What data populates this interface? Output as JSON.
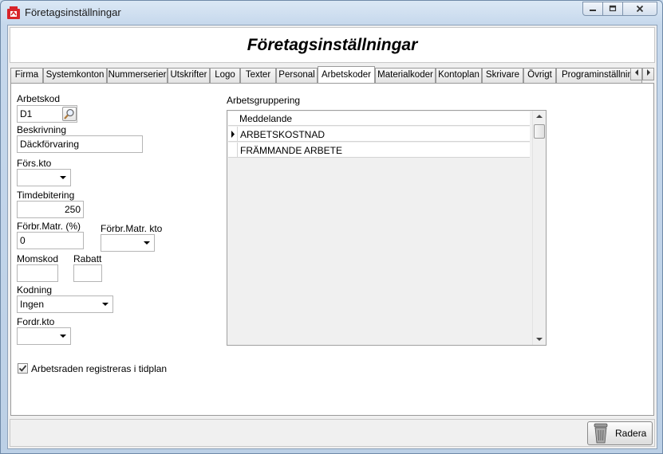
{
  "window": {
    "title": "Företagsinställningar"
  },
  "header": {
    "title": "Företagsinställningar"
  },
  "tabs": [
    "Firma",
    "Systemkonton",
    "Nummerserier",
    "Utskrifter",
    "Logo",
    "Texter",
    "Personal",
    "Arbetskoder",
    "Materialkoder",
    "Kontoplan",
    "Skrivare",
    "Övrigt",
    "Programinställningar"
  ],
  "active_tab": "Arbetskoder",
  "form": {
    "arbetskod": {
      "label": "Arbetskod",
      "value": "D1"
    },
    "beskrivning": {
      "label": "Beskrivning",
      "value": "Däckförvaring"
    },
    "fors_kto": {
      "label": "Förs.kto",
      "value": ""
    },
    "timdebitering": {
      "label": "Timdebitering",
      "value": "250"
    },
    "forbr_matr_pct": {
      "label": "Förbr.Matr. (%)",
      "value": "0"
    },
    "forbr_matr_kto": {
      "label": "Förbr.Matr. kto",
      "value": ""
    },
    "momskod": {
      "label": "Momskod",
      "value": ""
    },
    "rabatt": {
      "label": "Rabatt",
      "value": ""
    },
    "kodning": {
      "label": "Kodning",
      "value": "Ingen"
    },
    "fordr_kto": {
      "label": "Fordr.kto",
      "value": ""
    },
    "registreras": {
      "label": "Arbetsraden registreras i tidplan",
      "checked": true
    }
  },
  "grouping": {
    "label": "Arbetsgruppering",
    "column": "Meddelande",
    "rows": [
      "ARBETSKOSTNAD",
      "FRÄMMANDE ARBETE"
    ]
  },
  "footer": {
    "delete_label": "Radera"
  }
}
